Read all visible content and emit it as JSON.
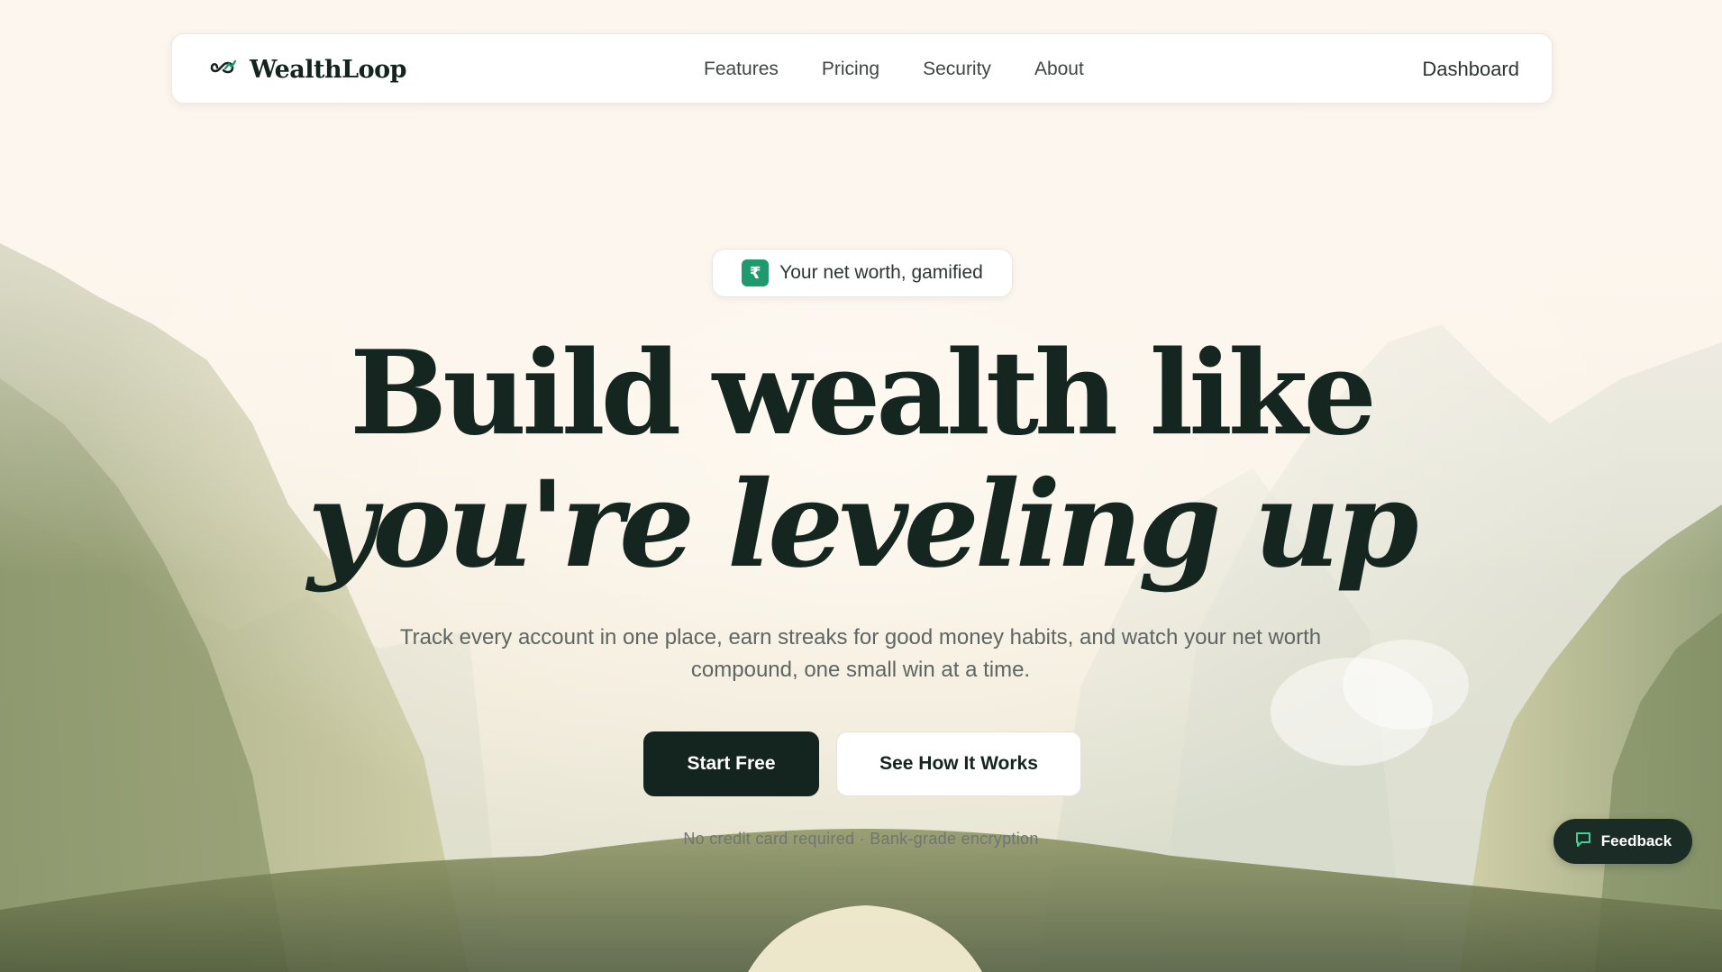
{
  "nav": {
    "brand": "WealthLoop",
    "links": [
      {
        "label": "Features"
      },
      {
        "label": "Pricing"
      },
      {
        "label": "Security"
      },
      {
        "label": "About"
      }
    ],
    "dashboard_label": "Dashboard"
  },
  "hero": {
    "badge_icon": "₹",
    "badge_text": "Your net worth, gamified",
    "headline_line1": "Build wealth like",
    "headline_line2": "you're leveling up",
    "subtitle": "Track every account in one place, earn streaks for good money habits, and watch your net worth compound, one small win at a time.",
    "primary_cta": "Start Free",
    "secondary_cta": "See How It Works",
    "fineprint": "No credit card required · Bank-grade encryption"
  },
  "feedback": {
    "label": "Feedback",
    "icon": "chat-bubble-icon"
  },
  "colors": {
    "background": "#fcf6ef",
    "ink": "#152620",
    "accent": "#1f9a6e",
    "primary_button": "#14241e"
  }
}
